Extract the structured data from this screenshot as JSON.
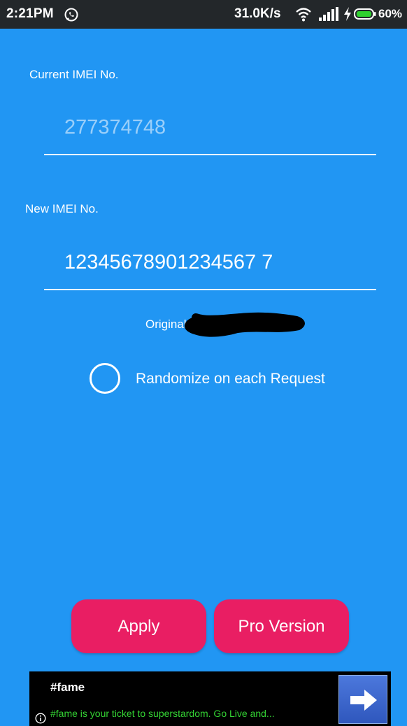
{
  "status_bar": {
    "time": "2:21PM",
    "net_speed": "31.0K/s",
    "battery": "60%",
    "icons": [
      "whatsapp-icon",
      "wifi-icon",
      "signal-icon",
      "charging-bolt-icon",
      "battery-icon"
    ],
    "background": "#23272a"
  },
  "colors": {
    "primary": "#2196f3",
    "accent": "#e91e63",
    "ad_text": "#34d334"
  },
  "current_imei": {
    "label": "Current IMEI No.",
    "placeholder": "277374748"
  },
  "new_imei": {
    "label": "New IMEI No.",
    "value": "12345678901234567 7"
  },
  "original": {
    "label": "Original :"
  },
  "randomize": {
    "label": "Randomize on each Request",
    "checked": false
  },
  "buttons": {
    "apply": "Apply",
    "pro": "Pro Version"
  },
  "ad": {
    "title": "#fame",
    "description": "#fame is your ticket to superstardom. Go Live and...",
    "icons": [
      "info-icon",
      "arrow-right-icon"
    ]
  }
}
